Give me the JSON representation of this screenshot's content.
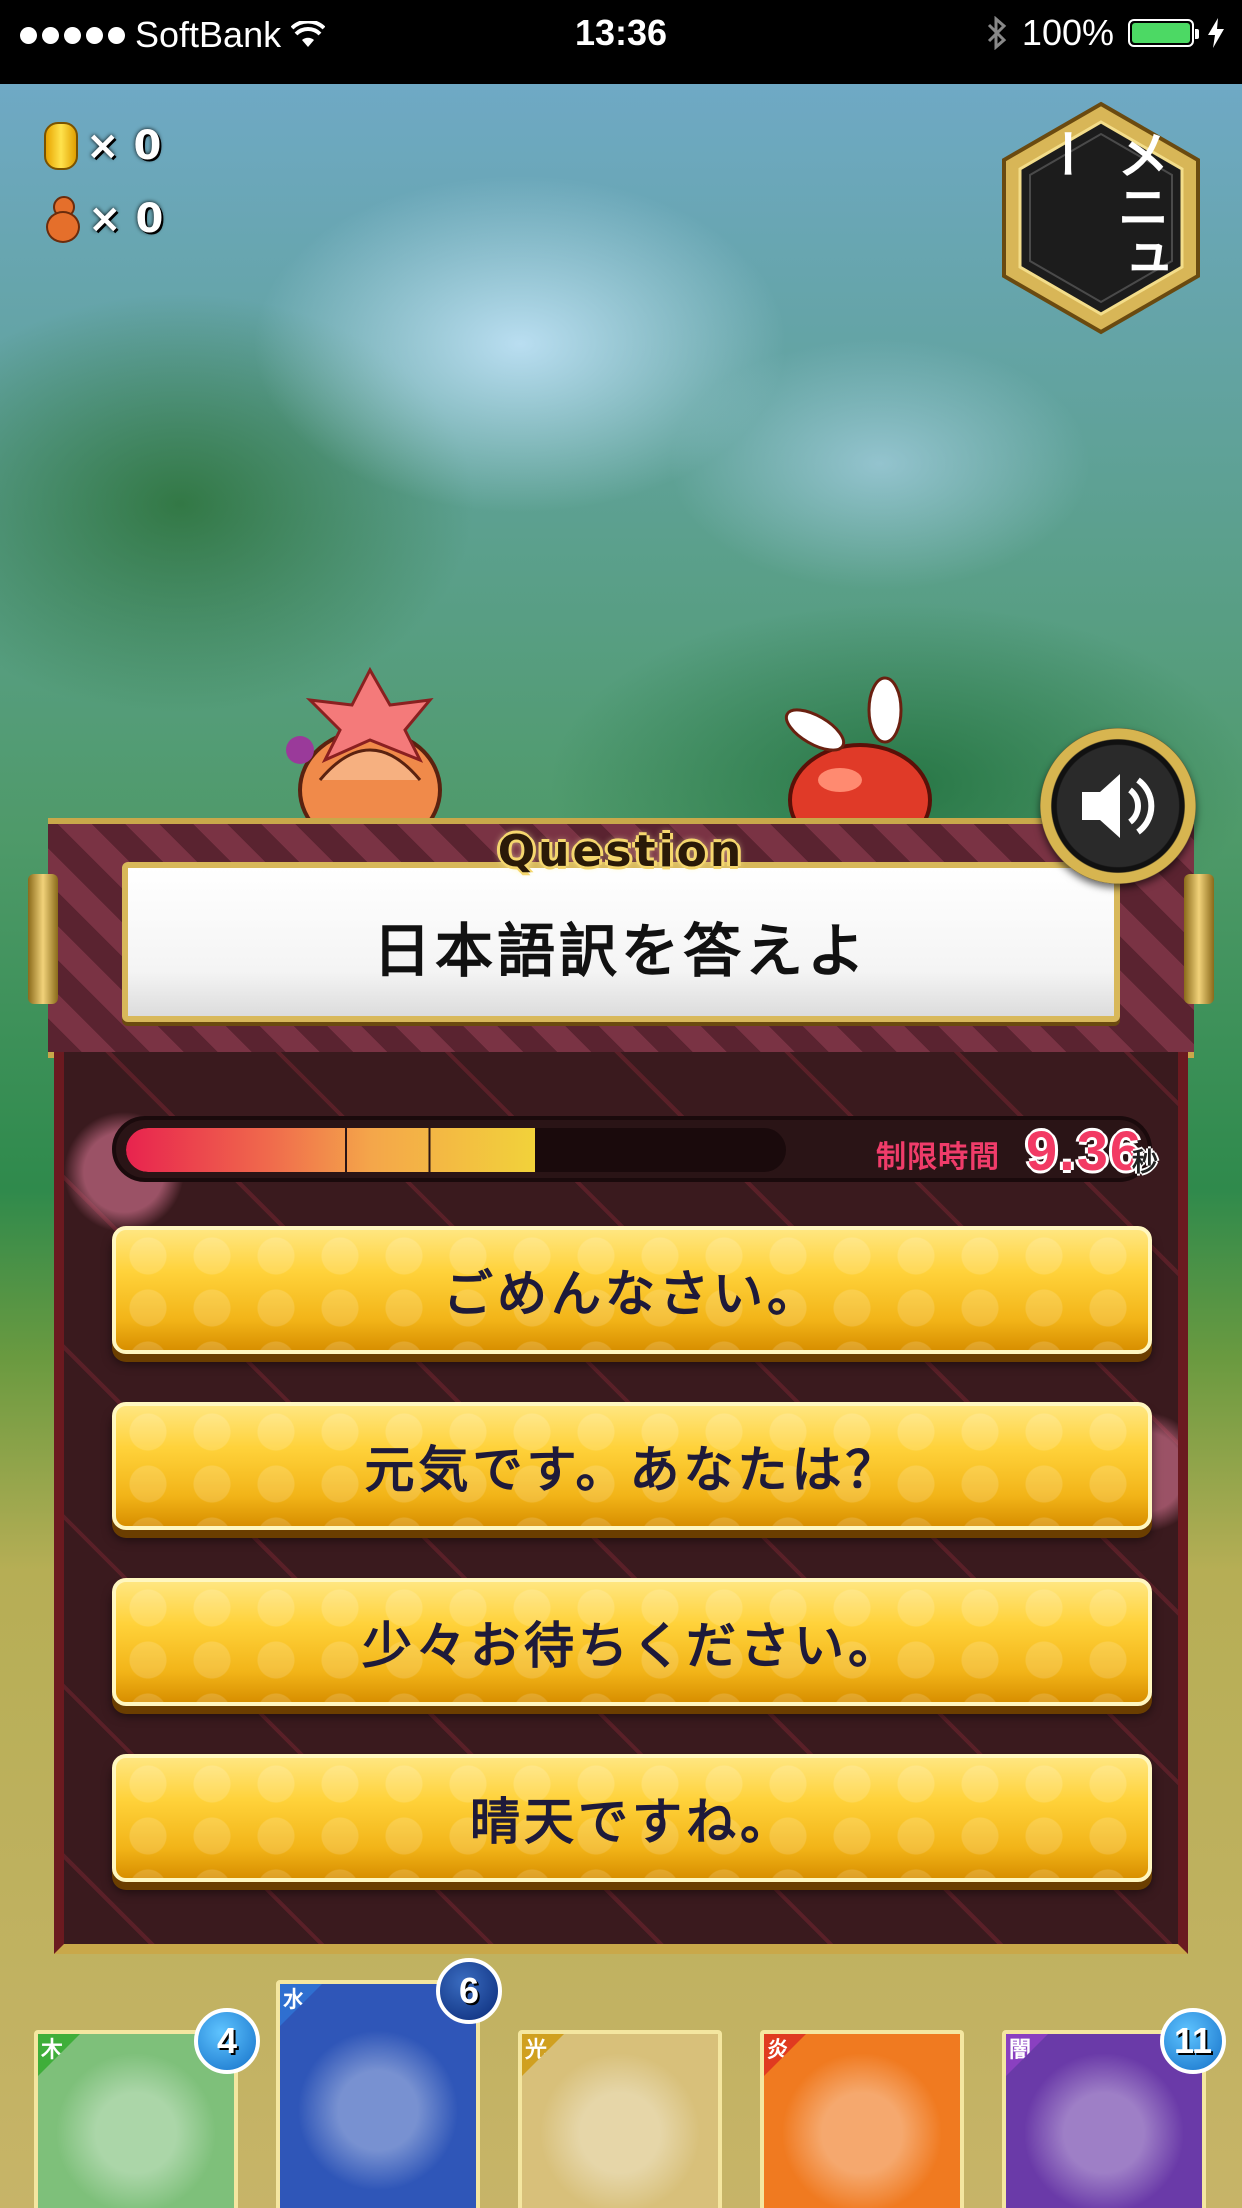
{
  "status_bar": {
    "carrier": "SoftBank",
    "time": "13:36",
    "battery": "100%"
  },
  "currency": {
    "coins_label": "× 0",
    "gourds_label": "× 0"
  },
  "menu": {
    "label": "メニュー"
  },
  "question": {
    "heading": "Question",
    "prompt": "日本語訳を答えよ"
  },
  "timer": {
    "label": "制限時間",
    "value": "9.36",
    "unit": "秒",
    "remaining_fraction": 0.62
  },
  "answers": [
    {
      "label": "ごめんなさい。"
    },
    {
      "label": "元気です。あなたは？"
    },
    {
      "label": "少々お待ちください。"
    },
    {
      "label": "晴天ですね。"
    }
  ],
  "cards": [
    {
      "element": "木",
      "element_color": "#3fae3a",
      "badge": "4",
      "art": "#7ec07a"
    },
    {
      "element": "水",
      "element_color": "#2f6fd0",
      "badge": "6",
      "art": "#2f56b8"
    },
    {
      "element": "光",
      "element_color": "#d0a020",
      "badge": "",
      "art": "#d8c07a"
    },
    {
      "element": "炎",
      "element_color": "#e03a20",
      "badge": "",
      "art": "#f07a20"
    },
    {
      "element": "闇",
      "element_color": "#8a40c0",
      "badge": "11",
      "art": "#6a3aa8"
    }
  ],
  "icons": {
    "wifi": "wifi-icon",
    "bluetooth": "bluetooth-icon",
    "charging": "bolt-icon",
    "sound": "speaker-icon"
  }
}
